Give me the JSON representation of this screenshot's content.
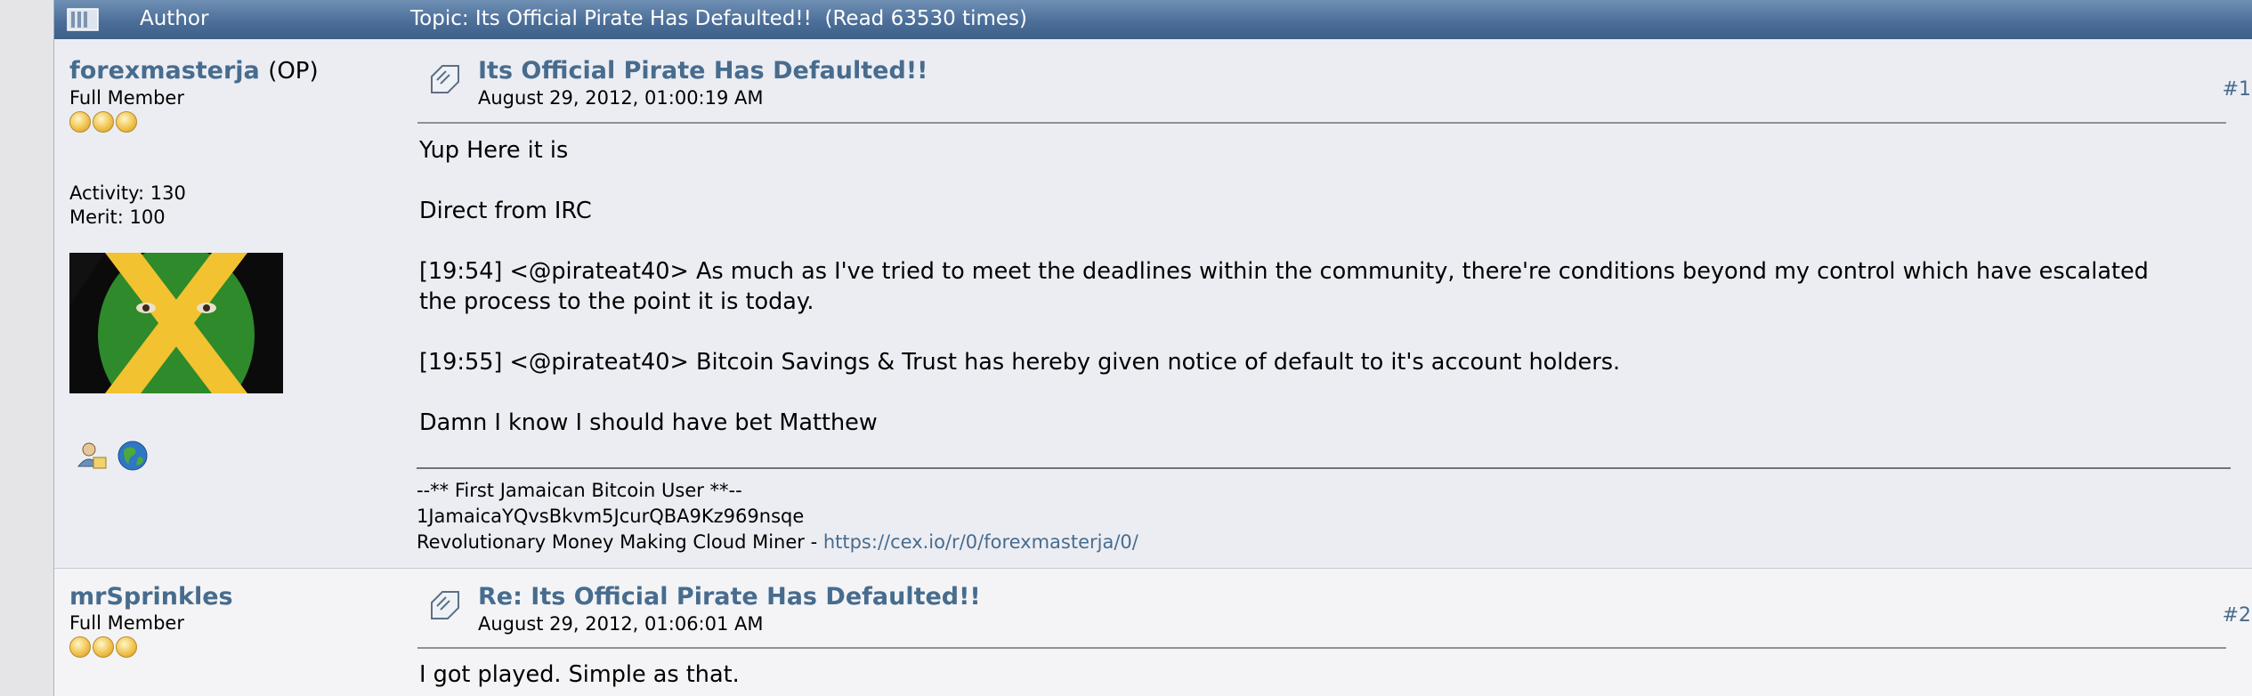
{
  "header": {
    "author_label": "Author",
    "topic_label": "Topic: Its Official Pirate Has Defaulted!!  (Read 63530 times)"
  },
  "posts": [
    {
      "author": "forexmasterja",
      "op_tag": "(OP)",
      "rank": "Full Member",
      "stars": 3,
      "activity": "Activity: 130",
      "merit": "Merit: 100",
      "subject": "Its Official Pirate Has Defaulted!!",
      "date": "August 29, 2012, 01:00:19 AM",
      "number": "#1",
      "body": [
        "Yup Here it is",
        "Direct from IRC",
        "[19:54] <@pirateat40> As much as I've tried to meet the deadlines within the community, there're conditions beyond my control which have escalated",
        "the process to the point it is today.",
        "[19:55] <@pirateat40> Bitcoin Savings & Trust has hereby given notice of default to it's account holders.",
        "Damn I know I should have bet Matthew"
      ],
      "signature": {
        "line1": "--** First Jamaican Bitcoin User **--",
        "line2": "1JamaicaYQvsBkvm5JcurQBA9Kz969nsqe",
        "line3_text": "Revolutionary Money Making Cloud Miner - ",
        "line3_link": "https://cex.io/r/0/forexmasterja/0/"
      }
    },
    {
      "author": "mrSprinkles",
      "rank": "Full Member",
      "stars": 3,
      "subject": "Re: Its Official Pirate Has Defaulted!!",
      "date": "August 29, 2012, 01:06:01 AM",
      "number": "#2",
      "body": [
        "I got played. Simple as that."
      ]
    }
  ],
  "colors": {
    "header": "#4c6f99",
    "link": "#476c8e",
    "post_bg": "#ecedf3",
    "alt_bg": "#f4f4f6"
  },
  "icons": [
    "topic-icon",
    "xx-post-icon",
    "profile-icon",
    "website-globe-icon",
    "star-icon"
  ]
}
